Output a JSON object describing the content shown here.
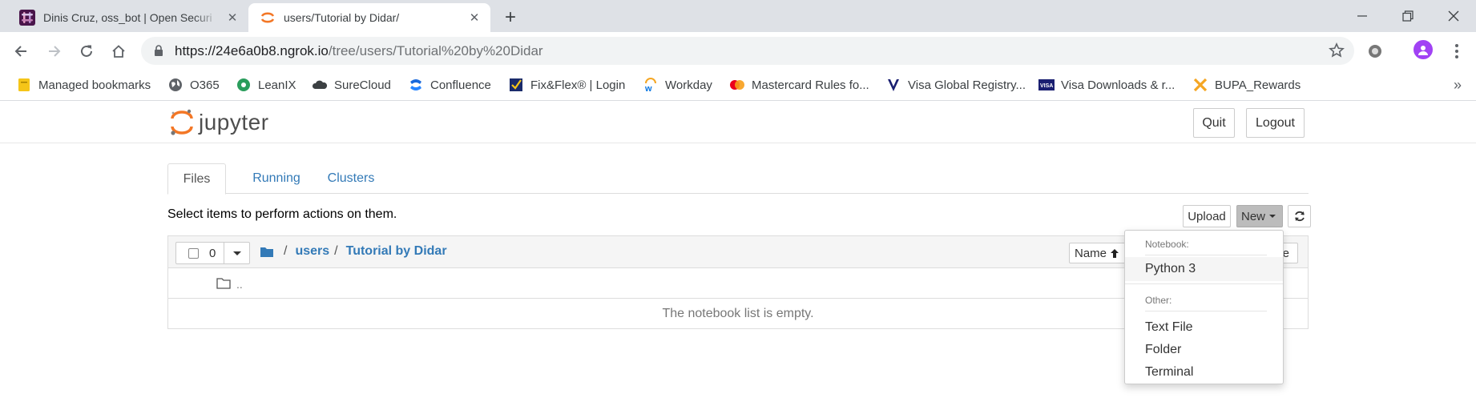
{
  "browser": {
    "tabs": [
      {
        "title": "Dinis Cruz, oss_bot | Open Securi",
        "favicon": "slack-icon",
        "active": false
      },
      {
        "title": "users/Tutorial by Didar/",
        "favicon": "jupyter-icon",
        "active": true
      }
    ],
    "new_tab": "+",
    "url_host": "https://24e6a0b8.ngrok.io",
    "url_path": "/tree/users/Tutorial%20by%20Didar",
    "bookmarks": [
      {
        "label": "Managed bookmarks",
        "icon": "folder-icon"
      },
      {
        "label": "O365",
        "icon": "globe-icon"
      },
      {
        "label": "LeanIX",
        "icon": "leanix-icon"
      },
      {
        "label": "SureCloud",
        "icon": "cloud-icon"
      },
      {
        "label": "Confluence",
        "icon": "confluence-icon"
      },
      {
        "label": "Fix&Flex® | Login",
        "icon": "fixflex-icon"
      },
      {
        "label": "Workday",
        "icon": "workday-icon"
      },
      {
        "label": "Mastercard Rules fo...",
        "icon": "mastercard-icon"
      },
      {
        "label": "Visa Global Registry...",
        "icon": "visa-v-icon"
      },
      {
        "label": "Visa Downloads & r...",
        "icon": "visa-card-icon"
      },
      {
        "label": "BUPA_Rewards",
        "icon": "bupa-icon"
      }
    ],
    "bookmarks_overflow": "»"
  },
  "jupyter": {
    "logo_text": "jupyter",
    "quit_label": "Quit",
    "logout_label": "Logout",
    "tabs": [
      "Files",
      "Running",
      "Clusters"
    ],
    "notice": "Select items to perform actions on them.",
    "upload_label": "Upload",
    "new_label": "New",
    "selected_count": "0",
    "breadcrumb": [
      "users",
      "Tutorial by Didar"
    ],
    "breadcrumb_sep": "/",
    "sort_name_label": "Name",
    "sort_size_label": "ze",
    "parent_dir": "..",
    "empty_message": "The notebook list is empty.",
    "new_menu": {
      "notebook_header": "Notebook:",
      "notebook_items": [
        "Python 3"
      ],
      "other_header": "Other:",
      "other_items": [
        "Text File",
        "Folder",
        "Terminal"
      ]
    }
  },
  "colors": {
    "link": "#337ab7",
    "jupyter_orange": "#f37726",
    "chrome_strip": "#dee1e6"
  }
}
